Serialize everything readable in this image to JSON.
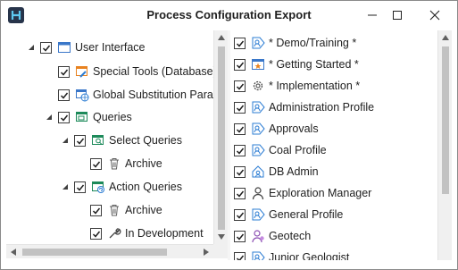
{
  "window": {
    "title": "Process Configuration Export"
  },
  "icons": {
    "app": "app-logo-icon",
    "minimize": "minimize-icon",
    "maximize": "maximize-icon",
    "close": "close-icon"
  },
  "left_tree": {
    "items": [
      {
        "label": "User Interface",
        "icon": "window-icon",
        "checked": true,
        "expander": "expanded",
        "level": 0
      },
      {
        "label": "Special Tools (Database)",
        "icon": "wrench-window-icon",
        "checked": true,
        "expander": "none",
        "level": 1
      },
      {
        "label": "Global Substitution Param",
        "icon": "globe-window-icon",
        "checked": true,
        "expander": "none",
        "level": 1
      },
      {
        "label": "Queries",
        "icon": "query-window-icon",
        "checked": true,
        "expander": "expanded",
        "level": 1
      },
      {
        "label": "Select Queries",
        "icon": "search-window-icon",
        "checked": true,
        "expander": "expanded",
        "level": 2
      },
      {
        "label": "Archive",
        "icon": "trash-icon",
        "checked": true,
        "expander": "none",
        "level": 3
      },
      {
        "label": "Action Queries",
        "icon": "refresh-window-icon",
        "checked": true,
        "expander": "expanded",
        "level": 2
      },
      {
        "label": "Archive",
        "icon": "trash-icon",
        "checked": true,
        "expander": "none",
        "level": 3
      },
      {
        "label": "In Development",
        "icon": "wrench-icon",
        "checked": true,
        "expander": "none",
        "level": 3
      }
    ]
  },
  "right_list": {
    "items": [
      {
        "label": "* Demo/Training *",
        "icon": "profile-arrow-icon",
        "checked": true
      },
      {
        "label": "* Getting Started *",
        "icon": "star-window-icon",
        "checked": true
      },
      {
        "label": "* Implementation *",
        "icon": "gear-icon",
        "checked": true
      },
      {
        "label": "Administration Profile",
        "icon": "profile-arrow-icon",
        "checked": true
      },
      {
        "label": "Approvals",
        "icon": "profile-arrow-icon",
        "checked": true
      },
      {
        "label": "Coal Profile",
        "icon": "profile-arrow-icon",
        "checked": true
      },
      {
        "label": "DB Admin",
        "icon": "house-profile-icon",
        "checked": true
      },
      {
        "label": "Exploration Manager",
        "icon": "person-icon",
        "checked": true
      },
      {
        "label": "General Profile",
        "icon": "profile-arrow-icon",
        "checked": true
      },
      {
        "label": "Geotech",
        "icon": "geotech-icon",
        "checked": true
      },
      {
        "label": "Junior Geologist",
        "icon": "profile-arrow-icon",
        "checked": true
      }
    ]
  },
  "colors": {
    "accent_blue": "#2b7cd3",
    "window_icon_blue": "#3a77c9",
    "orange": "#e8821f",
    "purple": "#8c4fb3"
  }
}
